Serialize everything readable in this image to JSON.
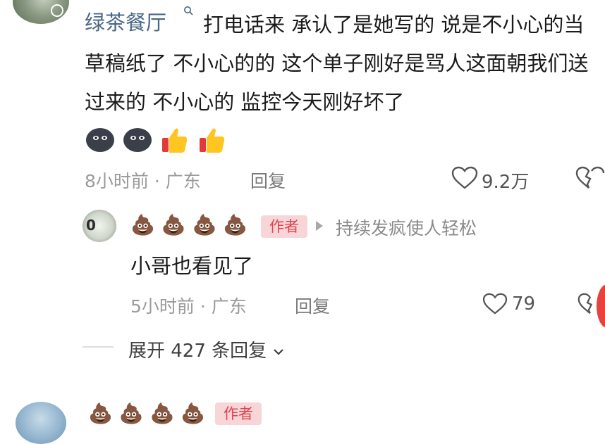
{
  "main_comment": {
    "username": "绿茶餐厅",
    "verify_icon": "search-icon",
    "text": "打电话来 承认了是她写的 说是不小心的当草稿纸了 不小心的的 这个单子刚好是骂人这面朝我们送过来的 不小心的 监控今天刚好坏了",
    "stickers": [
      "dark-face-sticker",
      "dark-face-sticker",
      "thumbs-up-sticker",
      "thumbs-up-sticker"
    ],
    "time_location": "8小时前 · 广东",
    "reply_label": "回复",
    "like_count": "9.2万"
  },
  "reply": {
    "avatar_text": "0",
    "username_emoji": "💩 💩 💩 💩",
    "author_badge": "作者",
    "reply_to": "持续发疯使人轻松",
    "text": "小哥也看见了",
    "time_location": "5小时前 · 广东",
    "reply_label": "回复",
    "like_count": "79"
  },
  "expand_replies": "展开 427 条回复",
  "next_comment": {
    "username_emoji": "💩 💩 💩 💩",
    "author_badge": "作者"
  },
  "colors": {
    "username_blue": "#4a6788",
    "badge_red": "#e0424f",
    "badge_bg": "#f8d6d8",
    "meta_gray": "#9a9a9a"
  }
}
